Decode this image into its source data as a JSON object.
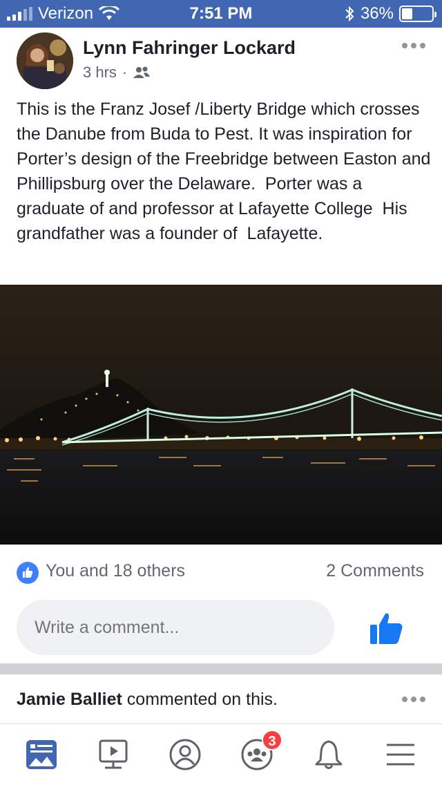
{
  "status_bar": {
    "carrier": "Verizon",
    "time": "7:51 PM",
    "battery_percent": "36%",
    "battery_level": 0.36,
    "icons": [
      "signal-icon",
      "wifi-icon",
      "bluetooth-icon",
      "battery-icon"
    ]
  },
  "post": {
    "author": "Lynn Fahringer Lockard",
    "timestamp": "3 hrs",
    "separator": "·",
    "audience_icon": "friends-icon",
    "text": "This is the Franz Josef /Liberty Bridge which crosses the Danube from Buda to Pest. It was inspiration for Porter’s design of the Freebridge between Easton and Phillipsburg over the Delaware.  Porter was a graduate of and professor at Lafayette College  His grandfather was a founder of  Lafayette.",
    "image_icon": "bridge-night-photo"
  },
  "reactions": {
    "summary": "You and 18 others",
    "comments": "2 Comments",
    "icon": "like-icon"
  },
  "comment_box": {
    "placeholder": "Write a comment...",
    "like_button_icon": "thumbs-up-icon"
  },
  "next_story": {
    "author": "Jamie Balliet",
    "action": " commented on this."
  },
  "tab_bar": {
    "tabs": [
      "news-feed-icon",
      "watch-icon",
      "profile-icon",
      "groups-icon",
      "notifications-icon",
      "menu-icon"
    ],
    "groups_badge": "3"
  },
  "colors": {
    "brand": "#4267b2",
    "like_blue": "#4080ff",
    "badge_red": "#fa3e3e"
  }
}
